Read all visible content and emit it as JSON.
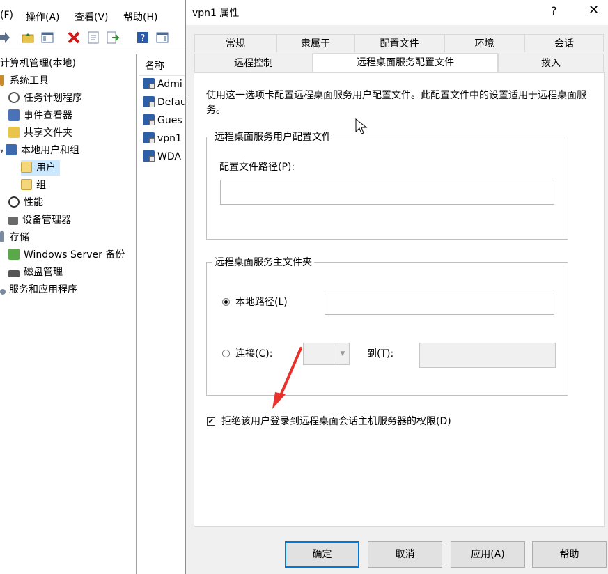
{
  "mmc": {
    "menu": [
      "(F)",
      "操作(A)",
      "查看(V)",
      "帮助(H)"
    ],
    "tree": [
      {
        "label": "计算机管理(本地)"
      },
      {
        "label": "系统工具"
      },
      {
        "label": "任务计划程序"
      },
      {
        "label": "事件查看器"
      },
      {
        "label": "共享文件夹"
      },
      {
        "label": "本地用户和组"
      },
      {
        "label": "用户"
      },
      {
        "label": "组"
      },
      {
        "label": "性能"
      },
      {
        "label": "设备管理器"
      },
      {
        "label": "存储"
      },
      {
        "label": "Windows Server 备份"
      },
      {
        "label": "磁盘管理"
      },
      {
        "label": "服务和应用程序"
      }
    ],
    "list_header": "名称",
    "list_items": [
      "Admi",
      "Defau",
      "Gues",
      "vpn1",
      "WDA"
    ]
  },
  "dialog": {
    "title": "vpn1 属性",
    "help_glyph": "?",
    "close_glyph": "✕",
    "tabs_row1": [
      "常规",
      "隶属于",
      "配置文件",
      "环境",
      "会话"
    ],
    "tabs_row2": [
      "远程控制",
      "远程桌面服务配置文件",
      "拨入"
    ],
    "active_tab": "远程桌面服务配置文件",
    "description": "使用这一选项卡配置远程桌面服务用户配置文件。此配置文件中的设置适用于远程桌面服务。",
    "profile_group": {
      "title": "远程桌面服务用户配置文件",
      "path_label": "配置文件路径(P):",
      "path_value": ""
    },
    "home_group": {
      "title": "远程桌面服务主文件夹",
      "local_path_label": "本地路径(L)",
      "local_path_value": "",
      "local_selected": true,
      "connect_label": "连接(C):",
      "drive_value": "",
      "to_label": "到(T):",
      "to_value": ""
    },
    "deny_label": "拒绝该用户登录到远程桌面会话主机服务器的权限(D)",
    "deny_checked": true,
    "buttons": {
      "ok": "确定",
      "cancel": "取消",
      "apply": "应用(A)",
      "help": "帮助"
    },
    "annotation_arrow_color": "#e8322b"
  }
}
